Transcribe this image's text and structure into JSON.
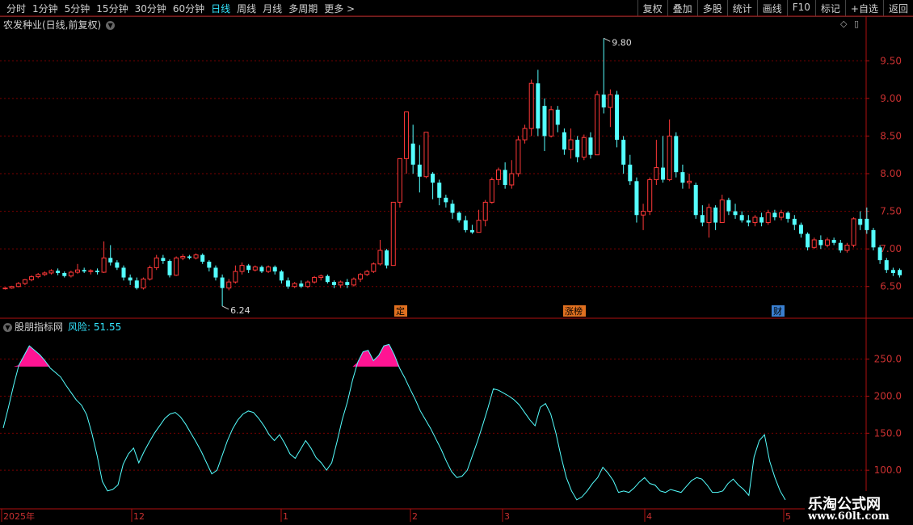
{
  "toolbar": {
    "periods": [
      "分时",
      "1分钟",
      "5分钟",
      "15分钟",
      "30分钟",
      "60分钟",
      "日线",
      "周线",
      "月线",
      "多周期",
      "更多 >"
    ],
    "active_period": "日线",
    "actions": [
      "复权",
      "叠加",
      "多股",
      "统计",
      "画线",
      "F10",
      "标记",
      "+自选",
      "返回"
    ]
  },
  "main_panel": {
    "title": "农发种业(日线,前复权)",
    "high_label": "9.80",
    "low_label": "6.24",
    "events": [
      {
        "label": "定",
        "color": "#e07020"
      },
      {
        "label": "涨榜",
        "color": "#e07020"
      },
      {
        "label": "财",
        "color": "#3a7fd0"
      }
    ]
  },
  "indicator_panel": {
    "title": "股朋指标网",
    "risk_label": "风险: 51.55"
  },
  "date_axis": [
    "2025年",
    "12",
    "1",
    "2",
    "3",
    "4",
    "5"
  ],
  "watermark": {
    "line1": "乐淘公式网",
    "line2": "www.60lt.com"
  },
  "colors": {
    "up": "#ff3838",
    "down": "#54ffff",
    "grid": "#7a0000",
    "border": "#b01010",
    "risk": "#ff1493",
    "line": "#54ffff"
  },
  "chart_data": [
    {
      "type": "candlestick",
      "title": "农发种业(日线,前复权)",
      "y_ticks": [
        6.5,
        7.0,
        7.5,
        8.0,
        8.5,
        9.0,
        9.5
      ],
      "ylim": [
        6.1,
        9.9
      ],
      "max": 9.8,
      "min": 6.24,
      "series": [
        {
          "name": "price",
          "values": [
            [
              6.47,
              6.48,
              6.46,
              6.49
            ],
            [
              6.48,
              6.5,
              6.47,
              6.51
            ],
            [
              6.5,
              6.54,
              6.49,
              6.56
            ],
            [
              6.54,
              6.59,
              6.52,
              6.6
            ],
            [
              6.59,
              6.63,
              6.57,
              6.65
            ],
            [
              6.63,
              6.66,
              6.61,
              6.68
            ],
            [
              6.66,
              6.68,
              6.64,
              6.7
            ],
            [
              6.68,
              6.71,
              6.66,
              6.73
            ],
            [
              6.71,
              6.68,
              6.65,
              6.74
            ],
            [
              6.68,
              6.64,
              6.62,
              6.7
            ],
            [
              6.64,
              6.69,
              6.62,
              6.71
            ],
            [
              6.69,
              6.72,
              6.67,
              6.8
            ],
            [
              6.72,
              6.7,
              6.68,
              6.75
            ],
            [
              6.7,
              6.71,
              6.66,
              6.73
            ],
            [
              6.71,
              6.69,
              6.66,
              6.74
            ],
            [
              6.69,
              6.88,
              6.68,
              7.1
            ],
            [
              6.88,
              6.82,
              6.78,
              7.05
            ],
            [
              6.82,
              6.75,
              6.72,
              6.85
            ],
            [
              6.75,
              6.62,
              6.58,
              6.78
            ],
            [
              6.62,
              6.58,
              6.52,
              6.66
            ],
            [
              6.58,
              6.48,
              6.46,
              6.62
            ],
            [
              6.48,
              6.6,
              6.46,
              6.62
            ],
            [
              6.6,
              6.75,
              6.58,
              6.78
            ],
            [
              6.75,
              6.88,
              6.72,
              6.92
            ],
            [
              6.88,
              6.84,
              6.8,
              6.92
            ],
            [
              6.84,
              6.65,
              6.62,
              6.86
            ],
            [
              6.65,
              6.88,
              6.64,
              6.9
            ],
            [
              6.88,
              6.9,
              6.85,
              6.93
            ],
            [
              6.9,
              6.88,
              6.86,
              6.92
            ],
            [
              6.88,
              6.92,
              6.86,
              6.94
            ],
            [
              6.92,
              6.83,
              6.8,
              6.94
            ],
            [
              6.83,
              6.75,
              6.7,
              6.85
            ],
            [
              6.75,
              6.62,
              6.58,
              6.78
            ],
            [
              6.62,
              6.48,
              6.24,
              6.66
            ],
            [
              6.48,
              6.56,
              6.45,
              6.6
            ],
            [
              6.56,
              6.7,
              6.54,
              6.78
            ],
            [
              6.7,
              6.78,
              6.66,
              6.82
            ],
            [
              6.78,
              6.72,
              6.68,
              6.8
            ],
            [
              6.72,
              6.76,
              6.7,
              6.78
            ],
            [
              6.76,
              6.7,
              6.68,
              6.78
            ],
            [
              6.7,
              6.76,
              6.68,
              6.78
            ],
            [
              6.76,
              6.7,
              6.66,
              6.78
            ],
            [
              6.7,
              6.58,
              6.54,
              6.72
            ],
            [
              6.58,
              6.5,
              6.47,
              6.62
            ],
            [
              6.5,
              6.54,
              6.48,
              6.56
            ],
            [
              6.54,
              6.5,
              6.48,
              6.58
            ],
            [
              6.5,
              6.56,
              6.48,
              6.58
            ],
            [
              6.56,
              6.62,
              6.54,
              6.64
            ],
            [
              6.62,
              6.64,
              6.58,
              6.66
            ],
            [
              6.64,
              6.56,
              6.54,
              6.66
            ],
            [
              6.56,
              6.52,
              6.48,
              6.58
            ],
            [
              6.52,
              6.56,
              6.48,
              6.58
            ],
            [
              6.56,
              6.52,
              6.48,
              6.6
            ],
            [
              6.52,
              6.6,
              6.5,
              6.62
            ],
            [
              6.6,
              6.66,
              6.56,
              6.68
            ],
            [
              6.66,
              6.7,
              6.64,
              6.72
            ],
            [
              6.7,
              6.8,
              6.68,
              6.82
            ],
            [
              6.8,
              6.98,
              6.78,
              7.12
            ],
            [
              6.98,
              6.78,
              6.74,
              7.0
            ],
            [
              6.78,
              7.62,
              6.78,
              7.62
            ],
            [
              7.62,
              8.2,
              7.55,
              8.2
            ],
            [
              8.2,
              8.82,
              8.0,
              8.82
            ],
            [
              8.4,
              8.12,
              8.0,
              8.65
            ],
            [
              8.12,
              7.96,
              7.75,
              8.38
            ],
            [
              7.96,
              8.55,
              7.94,
              8.55
            ],
            [
              8.0,
              7.88,
              7.66,
              8.02
            ],
            [
              7.88,
              7.68,
              7.58,
              7.92
            ],
            [
              7.68,
              7.62,
              7.55,
              7.72
            ],
            [
              7.6,
              7.48,
              7.4,
              7.65
            ],
            [
              7.48,
              7.38,
              7.35,
              7.5
            ],
            [
              7.38,
              7.25,
              7.22,
              7.44
            ],
            [
              7.25,
              7.22,
              7.2,
              7.32
            ],
            [
              7.22,
              7.38,
              7.22,
              7.52
            ],
            [
              7.38,
              7.62,
              7.3,
              7.65
            ],
            [
              7.62,
              7.92,
              7.6,
              7.95
            ],
            [
              7.92,
              8.05,
              7.85,
              8.08
            ],
            [
              8.05,
              7.85,
              7.8,
              8.15
            ],
            [
              7.85,
              8.0,
              7.8,
              8.18
            ],
            [
              8.0,
              8.45,
              7.96,
              8.5
            ],
            [
              8.45,
              8.6,
              8.4,
              8.65
            ],
            [
              8.6,
              9.2,
              8.5,
              9.25
            ],
            [
              9.2,
              8.6,
              8.5,
              9.38
            ],
            [
              8.9,
              8.5,
              8.3,
              9.0
            ],
            [
              8.5,
              8.85,
              8.48,
              8.9
            ],
            [
              8.85,
              8.65,
              8.55,
              8.9
            ],
            [
              8.55,
              8.32,
              8.25,
              8.6
            ],
            [
              8.32,
              8.45,
              8.2,
              8.6
            ],
            [
              8.45,
              8.22,
              8.15,
              8.5
            ],
            [
              8.22,
              8.48,
              8.18,
              8.52
            ],
            [
              8.48,
              8.25,
              8.2,
              8.55
            ],
            [
              8.25,
              9.05,
              8.25,
              9.1
            ],
            [
              9.05,
              8.88,
              8.8,
              9.8
            ],
            [
              8.88,
              9.05,
              8.62,
              9.12
            ],
            [
              9.05,
              8.45,
              8.35,
              9.1
            ],
            [
              8.45,
              8.12,
              8.0,
              8.5
            ],
            [
              8.12,
              7.9,
              7.85,
              8.25
            ],
            [
              7.9,
              7.45,
              7.35,
              7.95
            ],
            [
              7.45,
              7.5,
              7.25,
              7.6
            ],
            [
              7.5,
              7.92,
              7.45,
              7.95
            ],
            [
              7.92,
              8.08,
              7.85,
              8.45
            ],
            [
              8.08,
              7.92,
              7.88,
              8.5
            ],
            [
              7.92,
              8.5,
              7.9,
              8.72
            ],
            [
              8.5,
              8.02,
              7.95,
              8.55
            ],
            [
              8.02,
              7.88,
              7.8,
              8.12
            ],
            [
              7.88,
              7.9,
              7.8,
              8.0
            ],
            [
              7.85,
              7.45,
              7.4,
              7.88
            ],
            [
              7.45,
              7.35,
              7.3,
              7.58
            ],
            [
              7.35,
              7.55,
              7.15,
              7.6
            ],
            [
              7.55,
              7.35,
              7.25,
              7.58
            ],
            [
              7.35,
              7.65,
              7.35,
              7.72
            ],
            [
              7.65,
              7.5,
              7.45,
              7.68
            ],
            [
              7.5,
              7.45,
              7.4,
              7.6
            ],
            [
              7.45,
              7.38,
              7.35,
              7.5
            ],
            [
              7.38,
              7.35,
              7.3,
              7.45
            ],
            [
              7.35,
              7.42,
              7.3,
              7.45
            ],
            [
              7.42,
              7.35,
              7.3,
              7.48
            ],
            [
              7.35,
              7.48,
              7.32,
              7.52
            ],
            [
              7.48,
              7.42,
              7.38,
              7.52
            ],
            [
              7.42,
              7.48,
              7.38,
              7.52
            ],
            [
              7.48,
              7.4,
              7.35,
              7.5
            ],
            [
              7.4,
              7.32,
              7.25,
              7.45
            ],
            [
              7.32,
              7.2,
              7.15,
              7.35
            ],
            [
              7.2,
              7.02,
              6.98,
              7.22
            ],
            [
              7.02,
              7.12,
              7.0,
              7.15
            ],
            [
              7.12,
              7.05,
              7.0,
              7.18
            ],
            [
              7.05,
              7.12,
              7.02,
              7.15
            ],
            [
              7.12,
              7.08,
              7.05,
              7.15
            ],
            [
              7.08,
              6.98,
              6.95,
              7.12
            ],
            [
              6.98,
              7.05,
              6.95,
              7.08
            ],
            [
              7.05,
              7.4,
              7.02,
              7.42
            ],
            [
              7.4,
              7.32,
              7.25,
              7.5
            ],
            [
              7.4,
              7.25,
              7.2,
              7.55
            ],
            [
              7.25,
              7.02,
              6.98,
              7.28
            ],
            [
              7.02,
              6.85,
              6.8,
              7.05
            ],
            [
              6.85,
              6.72,
              6.68,
              6.88
            ],
            [
              6.72,
              6.68,
              6.64,
              6.75
            ],
            [
              6.72,
              6.65,
              6.62,
              6.74
            ]
          ]
        }
      ]
    },
    {
      "type": "line",
      "title": "股朋指标网",
      "y_ticks": [
        100.0,
        150.0,
        200.0,
        250.0
      ],
      "ylim": [
        50,
        290
      ],
      "threshold": 240,
      "series": [
        {
          "name": "风险",
          "values": [
            157,
            185,
            215,
            242,
            255,
            268,
            262,
            256,
            248,
            238,
            232,
            226,
            215,
            205,
            195,
            188,
            175,
            150,
            120,
            85,
            72,
            74,
            80,
            108,
            122,
            130,
            110,
            125,
            138,
            150,
            160,
            170,
            176,
            178,
            172,
            162,
            150,
            138,
            125,
            110,
            95,
            100,
            120,
            140,
            156,
            168,
            176,
            180,
            178,
            170,
            160,
            148,
            140,
            148,
            136,
            122,
            116,
            128,
            140,
            130,
            117,
            110,
            100,
            110,
            138,
            168,
            192,
            222,
            246,
            260,
            262,
            248,
            255,
            268,
            270,
            256,
            238,
            225,
            210,
            196,
            180,
            168,
            156,
            142,
            128,
            112,
            98,
            90,
            92,
            100,
            120,
            140,
            162,
            185,
            210,
            208,
            204,
            200,
            195,
            188,
            178,
            168,
            160,
            185,
            190,
            176,
            150,
            118,
            90,
            72,
            60,
            64,
            72,
            82,
            90,
            104,
            96,
            86,
            70,
            72,
            70,
            76,
            84,
            90,
            82,
            80,
            72,
            70,
            74,
            72,
            70,
            78,
            86,
            90,
            88,
            80,
            70,
            70,
            72,
            82,
            88,
            80,
            74,
            66,
            118,
            140,
            148,
            112,
            90,
            72,
            60
          ]
        }
      ]
    }
  ]
}
